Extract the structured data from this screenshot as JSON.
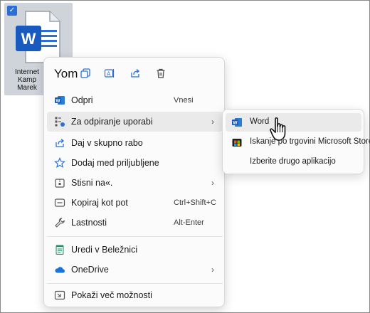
{
  "desktop_file": {
    "name_lines": [
      "Internet",
      "Kamp",
      "Marek"
    ],
    "selected": true
  },
  "quick_actions": {
    "title": "Yom",
    "buttons": [
      "copy-icon",
      "rename-icon",
      "share-icon",
      "delete-icon"
    ]
  },
  "menu": {
    "items": [
      {
        "label": "Odpri",
        "shortcut": "Vnesi",
        "icon": "word-icon"
      },
      {
        "label": "Za odpiranje uporabi",
        "icon": "open-with-icon",
        "submenu": true
      },
      {
        "label": "Daj v skupno rabo",
        "icon": "share-icon"
      },
      {
        "label": "Dodaj med priljubljene",
        "icon": "star-icon"
      },
      {
        "label": "Stisni na«.",
        "icon": "zip-icon",
        "submenu": true
      },
      {
        "label": "Kopiraj kot pot",
        "shortcut": "Ctrl+Shift+C",
        "icon": "copy-path-icon"
      },
      {
        "label": "Lastnosti",
        "shortcut": "Alt-Enter",
        "icon": "wrench-icon"
      },
      {
        "label": "Uredi v Beležnici",
        "icon": "notepad-icon"
      },
      {
        "label": "OneDrive",
        "icon": "onedrive-icon",
        "submenu": true
      },
      {
        "label": "Pokaži več možnosti",
        "icon": "more-options-icon"
      }
    ]
  },
  "submenu": {
    "items": [
      {
        "label": "Word",
        "icon": "word-icon"
      },
      {
        "label": "Iskanje po trgovini Microsoft Store",
        "icon": "store-icon"
      },
      {
        "label": "Izberite drugo aplikacijo",
        "icon": ""
      }
    ]
  },
  "colors": {
    "accent": "#2b6fd6",
    "word_blue": "#185abd",
    "hover": "#eaeaea"
  }
}
